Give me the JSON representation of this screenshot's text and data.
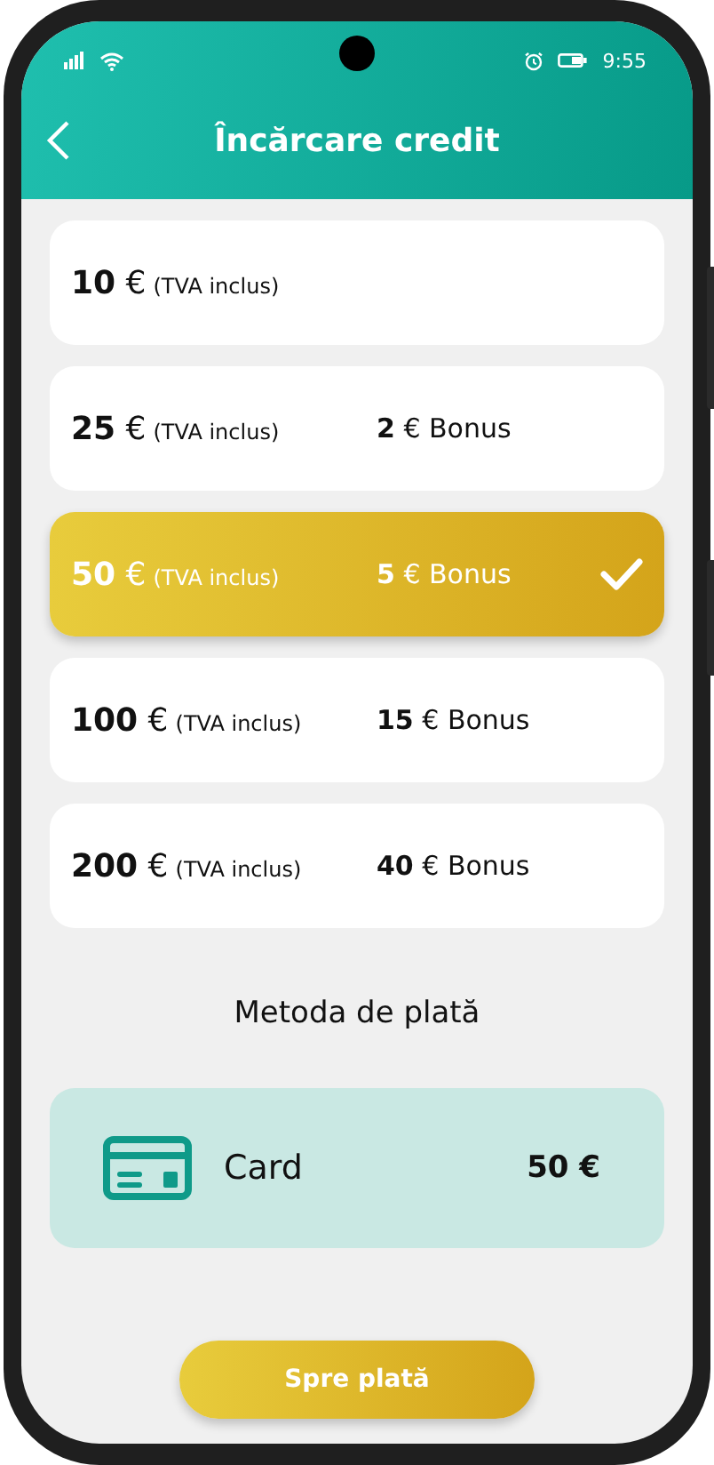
{
  "status_bar": {
    "time": "9:55"
  },
  "header": {
    "title": "Încărcare credit"
  },
  "options": [
    {
      "amount": "**10** €",
      "note": "(TVA inclus)",
      "selected": false
    },
    {
      "amount": "**25** €",
      "note": "(TVA inclus)",
      "bonus": "**2** € Bonus",
      "selected": false
    },
    {
      "amount": "**50** €",
      "note": "(TVA inclus)",
      "bonus": "**5** € Bonus",
      "selected": true
    },
    {
      "amount": "**100** €",
      "note": "(TVA inclus)",
      "bonus": "**15** € Bonus",
      "selected": false
    },
    {
      "amount": "**200** €",
      "note": "(TVA inclus)",
      "bonus": "**40** € Bonus",
      "selected": false
    }
  ],
  "payment": {
    "heading": "Metoda de plată",
    "method": "Card",
    "total": "50 €"
  },
  "submit_button": "Spre plată"
}
